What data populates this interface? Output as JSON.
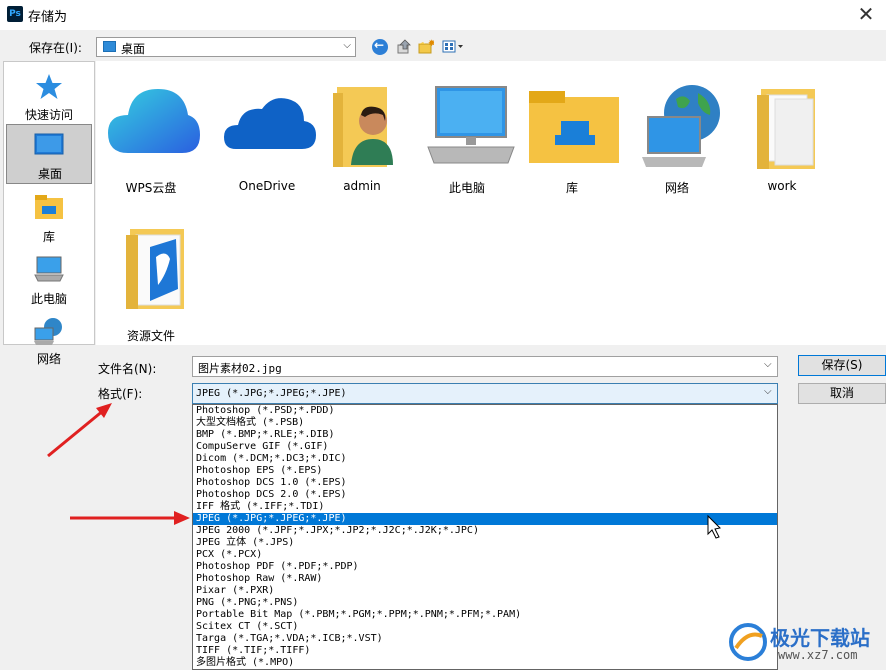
{
  "window": {
    "title": "存储为",
    "app_icon": "photoshop-icon"
  },
  "toolbar": {
    "save_in_label": "保存在(I):",
    "save_in_value": "桌面",
    "icons": [
      "back-arrow-icon",
      "up-folder-icon",
      "new-folder-icon",
      "view-menu-icon"
    ]
  },
  "sidebar": {
    "items": [
      {
        "label": "快速访问",
        "icon": "star-icon"
      },
      {
        "label": "桌面",
        "icon": "desktop-icon",
        "selected": true
      },
      {
        "label": "库",
        "icon": "library-icon"
      },
      {
        "label": "此电脑",
        "icon": "computer-icon"
      },
      {
        "label": "网络",
        "icon": "network-icon"
      }
    ]
  },
  "files": [
    {
      "label": "WPS云盘",
      "icon": "wps-cloud-icon"
    },
    {
      "label": "OneDrive",
      "icon": "onedrive-icon"
    },
    {
      "label": "admin",
      "icon": "user-folder-icon"
    },
    {
      "label": "此电脑",
      "icon": "computer-icon"
    },
    {
      "label": "库",
      "icon": "library-icon"
    },
    {
      "label": "网络",
      "icon": "network-icon"
    },
    {
      "label": "work",
      "icon": "folder-icon"
    },
    {
      "label": "资源文件",
      "icon": "folder-icon"
    }
  ],
  "form": {
    "filename_label": "文件名(N):",
    "filename_value": "图片素材02.jpg",
    "format_label": "格式(F):",
    "format_value": "JPEG (*.JPG;*.JPEG;*.JPE)",
    "save_button": "保存(S)",
    "cancel_button": "取消"
  },
  "format_options": [
    "Photoshop (*.PSD;*.PDD)",
    "大型文档格式 (*.PSB)",
    "BMP (*.BMP;*.RLE;*.DIB)",
    "CompuServe GIF (*.GIF)",
    "Dicom (*.DCM;*.DC3;*.DIC)",
    "Photoshop EPS (*.EPS)",
    "Photoshop DCS 1.0 (*.EPS)",
    "Photoshop DCS 2.0 (*.EPS)",
    "IFF 格式 (*.IFF;*.TDI)",
    "JPEG (*.JPG;*.JPEG;*.JPE)",
    "JPEG 2000 (*.JPF;*.JPX;*.JP2;*.J2C;*.J2K;*.JPC)",
    "JPEG 立体 (*.JPS)",
    "PCX (*.PCX)",
    "Photoshop PDF (*.PDF;*.PDP)",
    "Photoshop Raw (*.RAW)",
    "Pixar (*.PXR)",
    "PNG (*.PNG;*.PNS)",
    "Portable Bit Map (*.PBM;*.PGM;*.PPM;*.PNM;*.PFM;*.PAM)",
    "Scitex CT (*.SCT)",
    "Targa (*.TGA;*.VDA;*.ICB;*.VST)",
    "TIFF (*.TIF;*.TIFF)",
    "多图片格式 (*.MPO)"
  ],
  "selected_format_index": 9,
  "watermark": {
    "title": "极光下载站",
    "url": "www.xz7.com"
  },
  "colors": {
    "selection": "#0078d7",
    "annotation_arrow": "#e02020"
  }
}
